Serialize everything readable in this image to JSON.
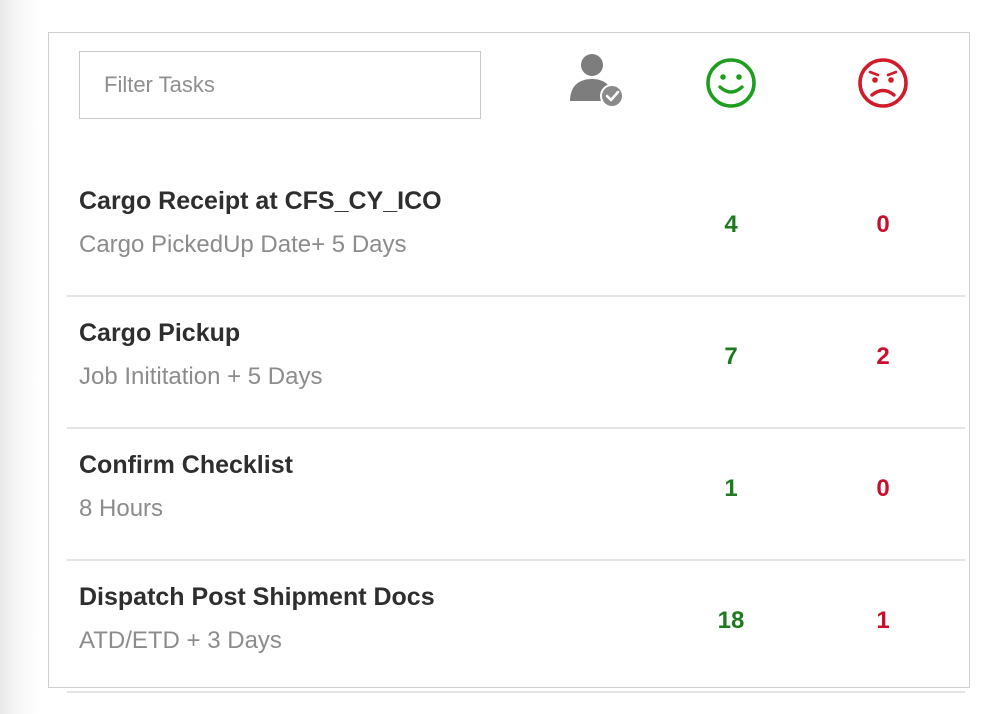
{
  "filter": {
    "placeholder": "Filter Tasks",
    "value": ""
  },
  "header_icons": [
    {
      "name": "user-check-icon",
      "color": "#7a7a7a"
    },
    {
      "name": "smile-icon",
      "color": "#1e9e1e"
    },
    {
      "name": "frown-icon",
      "color": "#d11a2a"
    }
  ],
  "colors": {
    "on_time": "#1e7a1e",
    "delayed": "#c8102e"
  },
  "tasks": [
    {
      "title": "Cargo Receipt at CFS_CY_ICO",
      "subtitle": "Cargo PickedUp Date+ 5 Days",
      "on_time": "4",
      "delayed": "0"
    },
    {
      "title": "Cargo Pickup",
      "subtitle": "Job Inititation + 5 Days",
      "on_time": "7",
      "delayed": "2"
    },
    {
      "title": "Confirm Checklist",
      "subtitle": "8 Hours",
      "on_time": "1",
      "delayed": "0"
    },
    {
      "title": "Dispatch Post Shipment Docs",
      "subtitle": "ATD/ETD + 3 Days",
      "on_time": "18",
      "delayed": "1"
    }
  ]
}
